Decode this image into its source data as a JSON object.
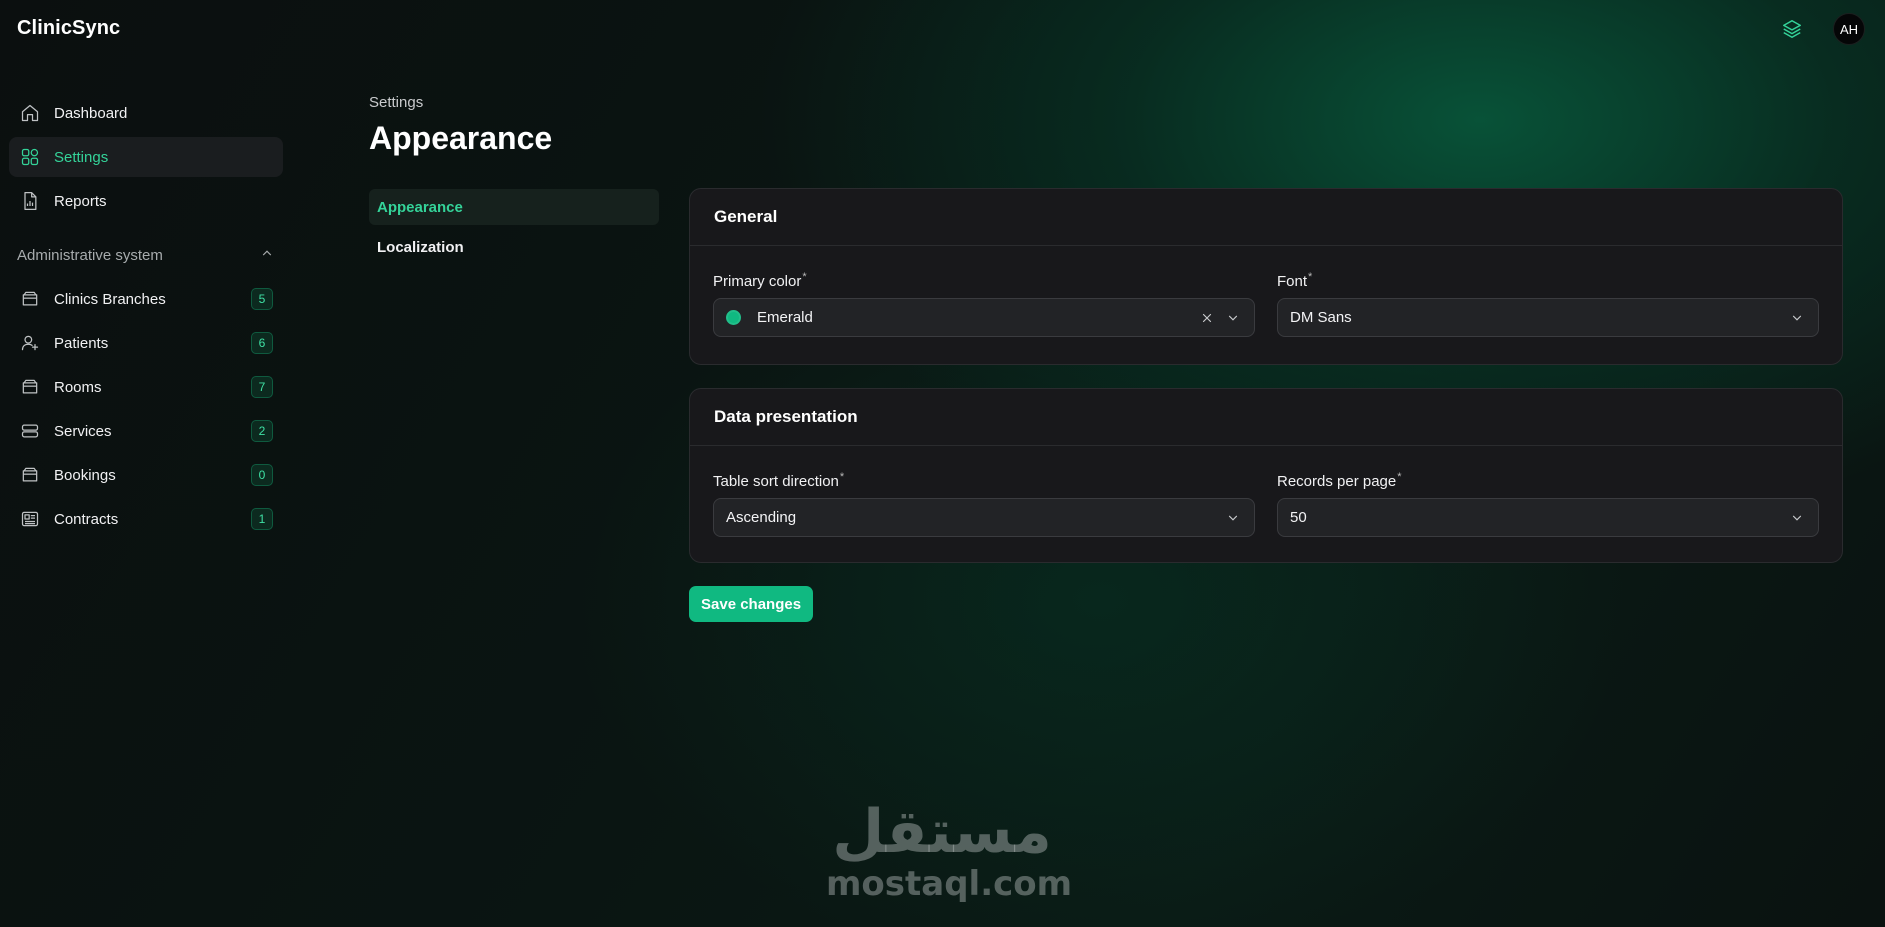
{
  "app": {
    "brand": "ClinicSync",
    "avatar_initials": "AH",
    "accent_color": "#10b981"
  },
  "sidebar": {
    "items": [
      {
        "label": "Dashboard",
        "icon": "home-icon"
      },
      {
        "label": "Settings",
        "icon": "grid-icon",
        "active": true
      },
      {
        "label": "Reports",
        "icon": "report-icon"
      }
    ],
    "group": {
      "label": "Administrative system",
      "expanded": true,
      "items": [
        {
          "label": "Clinics Branches",
          "count": "5"
        },
        {
          "label": "Patients",
          "count": "6"
        },
        {
          "label": "Rooms",
          "count": "7"
        },
        {
          "label": "Services",
          "count": "2"
        },
        {
          "label": "Bookings",
          "count": "0"
        },
        {
          "label": "Contracts",
          "count": "1"
        }
      ]
    }
  },
  "header": {
    "breadcrumb": "Settings",
    "title": "Appearance"
  },
  "subnav": {
    "items": [
      {
        "label": "Appearance",
        "active": true
      },
      {
        "label": "Localization"
      }
    ]
  },
  "general": {
    "title": "General",
    "primary_color": {
      "label": "Primary color",
      "required": "*",
      "value": "Emerald",
      "swatch": "#10b981"
    },
    "font": {
      "label": "Font",
      "required": "*",
      "value": "DM Sans"
    }
  },
  "data_presentation": {
    "title": "Data presentation",
    "sort_direction": {
      "label": "Table sort direction",
      "required": "*",
      "value": "Ascending"
    },
    "records_per_page": {
      "label": "Records per page",
      "required": "*",
      "value": "50"
    }
  },
  "actions": {
    "save_label": "Save changes"
  },
  "watermark": {
    "arabic": "مستقل",
    "latin": "mostaql.com"
  }
}
